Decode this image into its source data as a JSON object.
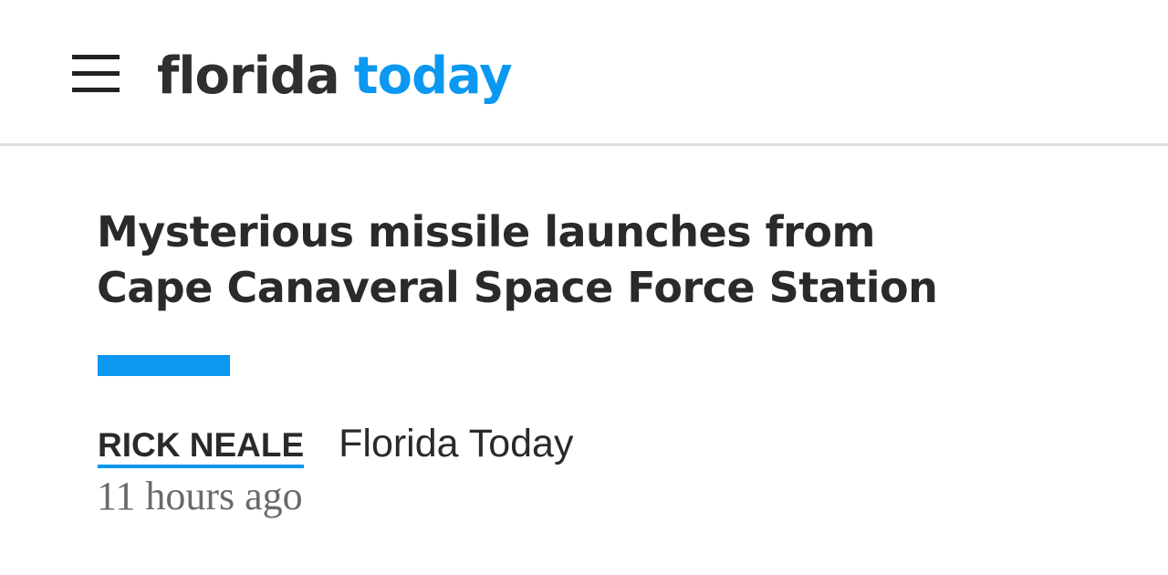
{
  "header": {
    "logo_primary": "florida",
    "logo_secondary": "today",
    "menu_icon": "hamburger-menu-icon"
  },
  "article": {
    "headline_line1": "Mysterious missile launches from",
    "headline_line2": "Cape Canaveral Space Force Station",
    "author": "RICK NEALE",
    "publication": "Florida Today",
    "timestamp": "11 hours ago"
  },
  "colors": {
    "brand_blue": "#0b98f0",
    "text_dark": "#2a2a2a",
    "text_muted": "#6a6a6a",
    "divider": "#e1e1e1"
  }
}
